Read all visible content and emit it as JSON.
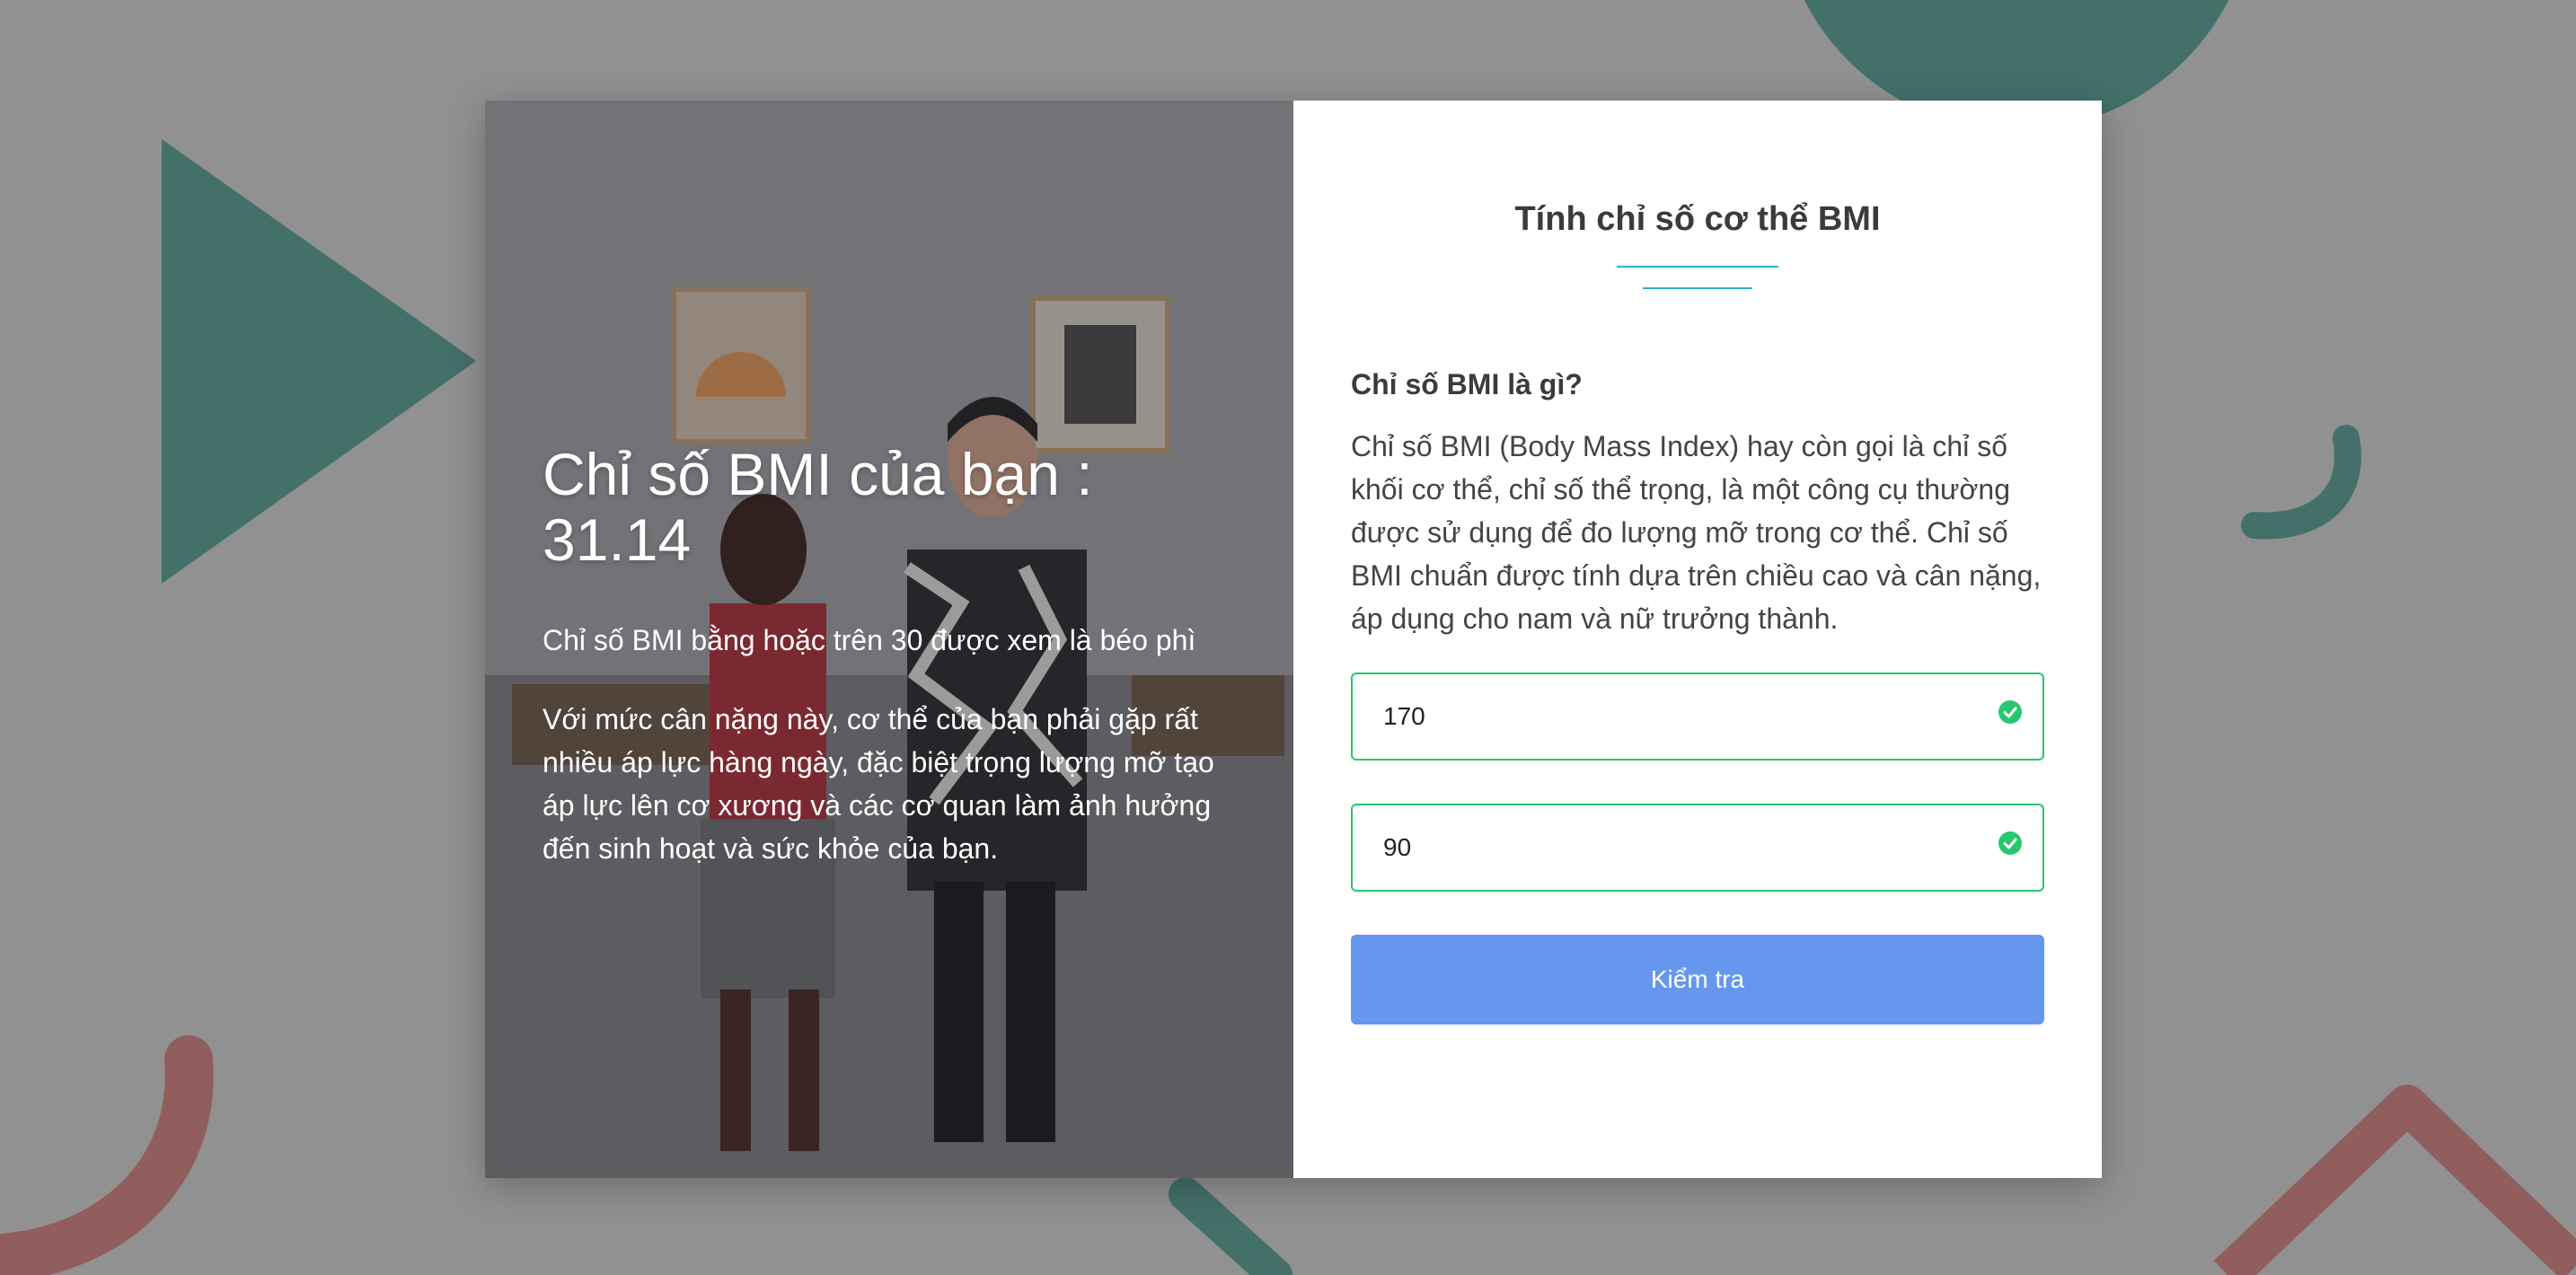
{
  "result": {
    "title": "Chỉ số BMI của bạn : 31.14",
    "subtitle": "Chỉ số BMI bằng hoặc trên 30 được xem là béo phì",
    "description": "Với mức cân nặng này, cơ thể của bạn phải gặp rất nhiều áp lực hàng ngày, đặc biệt trọng lượng mỡ tạo áp lực lên cơ xương và các cơ quan làm ảnh hưởng đến sinh hoạt và sức khỏe của bạn."
  },
  "form": {
    "title": "Tính chỉ số cơ thể BMI",
    "what_heading": "Chỉ số BMI là gì?",
    "what_text": "Chỉ số BMI (Body Mass Index) hay còn gọi là chỉ số khối cơ thể, chỉ số thể trọng, là một công cụ thường được sử dụng để đo lượng mỡ trong cơ thể. Chỉ số BMI chuẩn được tính dựa trên chiều cao và cân nặng, áp dụng cho nam và nữ trưởng thành.",
    "height_value": "170",
    "weight_value": "90",
    "submit_label": "Kiểm tra",
    "icons": {
      "valid": "check-circle-icon"
    }
  },
  "colors": {
    "accent": "#2bb3c9",
    "valid": "#28c76f",
    "button": "#6597ee",
    "shape_teal": "#5f9c94",
    "shape_red": "#c98282"
  }
}
